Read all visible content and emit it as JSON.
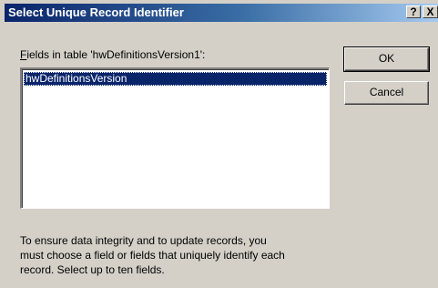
{
  "window": {
    "title": "Select Unique Record Identifier",
    "help_label": "?",
    "close_label": "X"
  },
  "fields": {
    "label_accel": "F",
    "label_rest": "ields in table 'hwDefinitionsVersion1':",
    "items": [
      "hwDefinitionsVersion"
    ],
    "selected_index": 0
  },
  "buttons": {
    "ok_label": "OK",
    "cancel_label": "Cancel"
  },
  "info": {
    "line1": "To ensure data integrity and to update records, you",
    "line2": "must choose a field or fields that uniquely identify each",
    "line3": "record. Select up to ten fields."
  },
  "colors": {
    "title_bar": "#0a246a",
    "selection": "#0a246a",
    "dialog_face": "#d4d0c8"
  }
}
